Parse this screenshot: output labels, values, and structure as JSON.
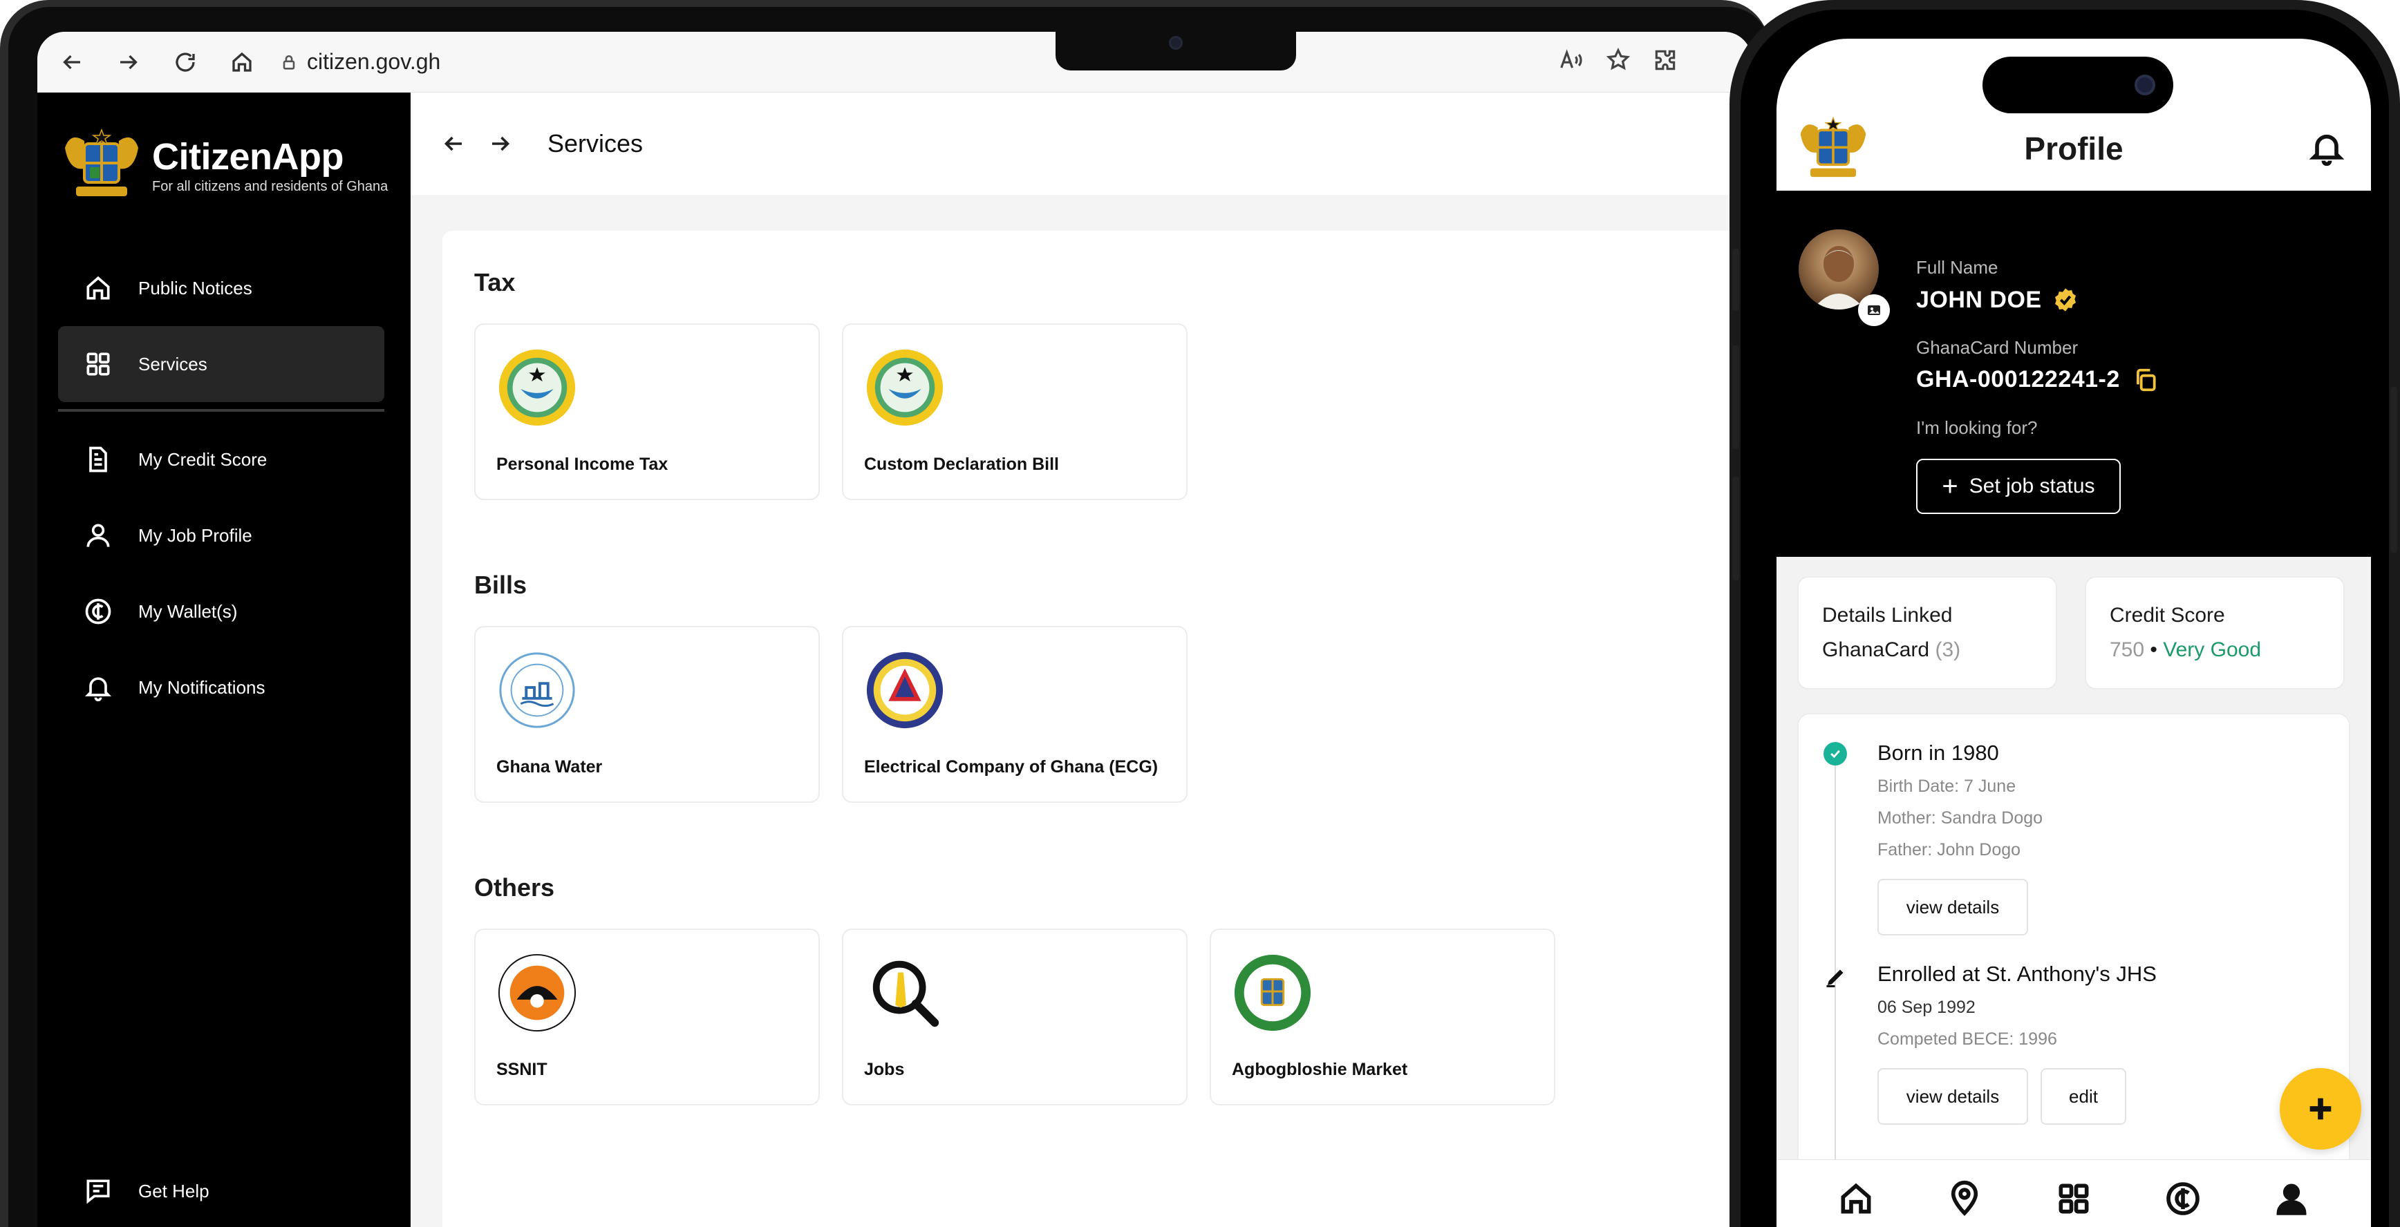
{
  "browser": {
    "url": "citizen.gov.gh"
  },
  "app": {
    "name": "CitizenApp",
    "tagline": "For all citizens and residents of Ghana"
  },
  "sidebar": {
    "items": [
      {
        "label": "Public Notices",
        "icon": "home-icon"
      },
      {
        "label": "Services",
        "icon": "grid-icon",
        "active": true
      },
      {
        "label": "My Credit Score",
        "icon": "document-icon"
      },
      {
        "label": "My Job Profile",
        "icon": "user-icon"
      },
      {
        "label": "My Wallet(s)",
        "icon": "cedi-icon"
      },
      {
        "label": "My Notifications",
        "icon": "bell-icon"
      }
    ],
    "help_label": "Get Help"
  },
  "page": {
    "title": "Services"
  },
  "services": {
    "tax": {
      "title": "Tax",
      "cards": [
        "Personal Income Tax",
        "Custom Declaration Bill"
      ]
    },
    "bills": {
      "title": "Bills",
      "cards": [
        "Ghana Water",
        "Electrical Company of Ghana (ECG)"
      ]
    },
    "others": {
      "title": "Others",
      "cards": [
        "SSNIT",
        "Jobs",
        "Agbogbloshie Market"
      ]
    }
  },
  "profile": {
    "title": "Profile",
    "full_name_label": "Full Name",
    "full_name": "JOHN DOE",
    "card_label": "GhanaCard Number",
    "card_number": "GHA-000122241-2",
    "looking_for_label": "I'm looking for?",
    "job_button": "Set job status",
    "details_linked_line1": "Details Linked",
    "details_linked_line2": "GhanaCard",
    "details_linked_count": "(3)",
    "credit_label": "Credit Score",
    "credit_value": "750",
    "credit_sep": "•",
    "credit_rating": "Very Good",
    "timeline": [
      {
        "title": "Born in 1980",
        "lines": [
          "Birth Date: 7 June",
          "Mother: Sandra Dogo",
          "Father: John Dogo"
        ],
        "buttons": [
          "view details"
        ]
      },
      {
        "title": "Enrolled at St. Anthony's JHS",
        "lines": [
          "06 Sep 1992",
          "Competed BECE: 1996"
        ],
        "buttons": [
          "view details",
          "edit"
        ]
      }
    ]
  },
  "colors": {
    "accent_yellow": "#fcc21a",
    "success_green": "#19b397",
    "rating_green": "#1a9a6a",
    "sidebar_bg": "#000000"
  }
}
